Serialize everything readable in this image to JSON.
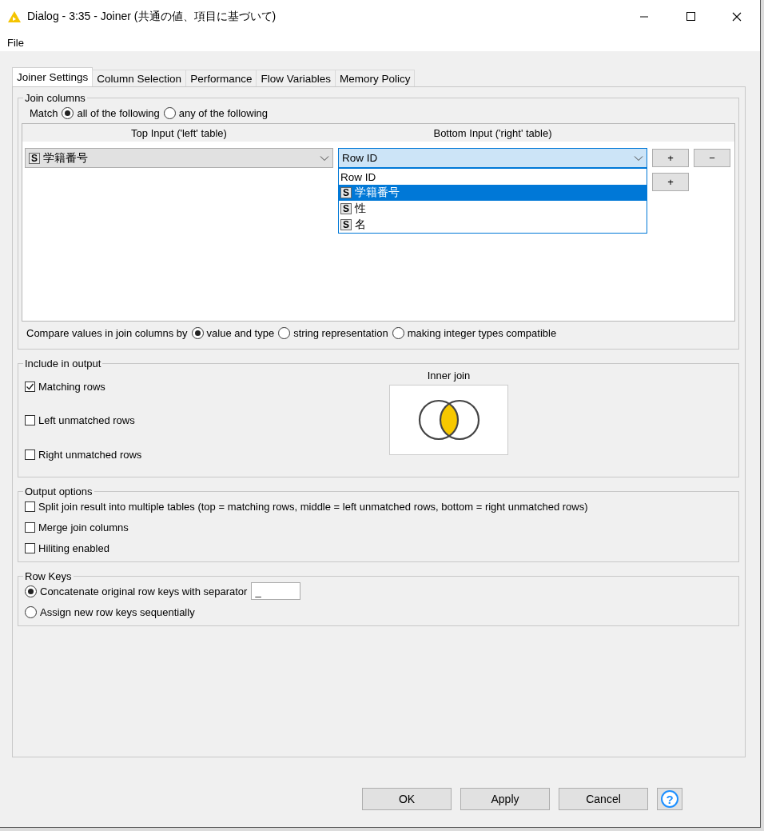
{
  "window": {
    "title": "Dialog - 3:35 - Joiner (共通の値、項目に基づいて)"
  },
  "menu": [
    "File"
  ],
  "tabs": [
    {
      "label": "Joiner Settings",
      "selected": true
    },
    {
      "label": "Column Selection",
      "selected": false
    },
    {
      "label": "Performance",
      "selected": false
    },
    {
      "label": "Flow Variables",
      "selected": false
    },
    {
      "label": "Memory Policy",
      "selected": false
    }
  ],
  "join_columns": {
    "title": "Join columns",
    "match_label": "Match",
    "match_options": [
      {
        "label": "all of the following",
        "selected": true
      },
      {
        "label": "any of the following",
        "selected": false
      }
    ],
    "columns": [
      "Top Input ('left' table)",
      "Bottom Input ('right' table)"
    ],
    "rows": [
      {
        "left": {
          "badge": "S",
          "value": "学籍番号"
        },
        "right": {
          "value": "Row ID"
        },
        "add_button": "+",
        "remove_button": "−"
      }
    ],
    "dropdown": [
      {
        "label": "Row ID",
        "selected": false
      },
      {
        "badge": "S",
        "label": "学籍番号",
        "selected": true
      },
      {
        "badge": "S",
        "label": "性",
        "selected": false
      },
      {
        "badge": "S",
        "label": "名",
        "selected": false
      }
    ],
    "new_row_button": "+",
    "compare_label": "Compare values in join columns by",
    "compare_options": [
      {
        "label": "value and type",
        "selected": true
      },
      {
        "label": "string representation",
        "selected": false
      },
      {
        "label": "making integer types compatible",
        "selected": false
      }
    ]
  },
  "include_output": {
    "title": "Include in output",
    "options": [
      {
        "label": "Matching rows",
        "checked": true
      },
      {
        "label": "Left unmatched rows",
        "checked": false
      },
      {
        "label": "Right unmatched rows",
        "checked": false
      }
    ],
    "diagram_title": "Inner join"
  },
  "output_options": {
    "title": "Output options",
    "options": [
      {
        "label": "Split join result into multiple tables (top = matching rows, middle = left unmatched rows, bottom = right unmatched rows)",
        "checked": false
      },
      {
        "label": "Merge join columns",
        "checked": false
      },
      {
        "label": "Hiliting enabled",
        "checked": false
      }
    ]
  },
  "row_keys": {
    "title": "Row Keys",
    "options": [
      {
        "label": "Concatenate original row keys with separator",
        "selected": true,
        "separator": "_"
      },
      {
        "label": "Assign new row keys sequentially",
        "selected": false
      }
    ]
  },
  "buttons": [
    "OK",
    "Apply",
    "Cancel"
  ],
  "help": "?"
}
